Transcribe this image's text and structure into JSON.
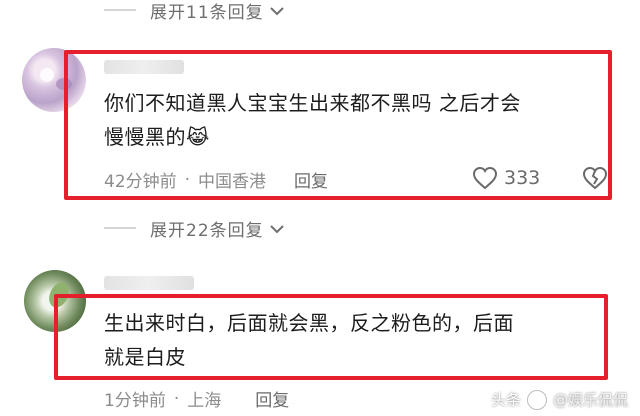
{
  "top_expand": {
    "label": "展开11条回复"
  },
  "comment_1": {
    "text_line1": "你们不知道黑人宝宝生出来都不黑吗 之后才会",
    "text_line2": "慢慢黑的",
    "emoji": "😹",
    "time": "42分钟前",
    "separator": "·",
    "location": "中国香港",
    "reply_label": "回复",
    "like_count": "333"
  },
  "mid_expand": {
    "label": "展开22条回复"
  },
  "comment_2": {
    "text_line1": "生出来时白，后面就会黑，反之粉色的，后面",
    "text_line2": "就是白皮",
    "time": "1分钟前",
    "separator": "·",
    "location": "上海",
    "reply_label": "回复"
  },
  "watermark": {
    "prefix": "头条",
    "account": "@娱乐侃侃"
  },
  "colors": {
    "highlight_box": "#e5202c",
    "meta_text": "#8c8c8c",
    "body_text": "#1c1c1c"
  },
  "icons": [
    "chevron-down-icon",
    "heart-icon",
    "broken-heart-icon",
    "toutiao-logo-icon"
  ]
}
